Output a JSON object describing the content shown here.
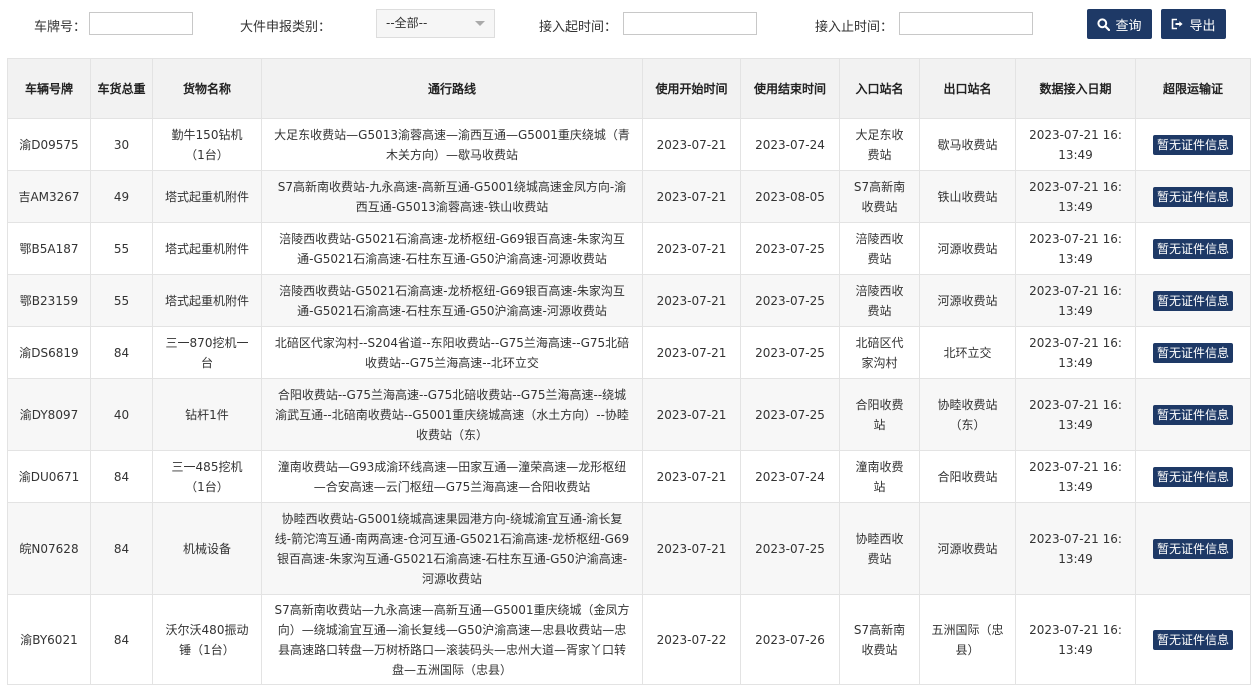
{
  "filters": {
    "plate_label": "车牌号：",
    "plate_value": "",
    "category_label": "大件申报类别：",
    "category_selected": "--全部--",
    "start_label": "接入起时间：",
    "start_value": "",
    "end_label": "接入止时间：",
    "end_value": "",
    "query_label": "查询",
    "export_label": "导出"
  },
  "icons": {
    "query": "search-icon",
    "export": "export-icon"
  },
  "colors": {
    "button": "#1e3966",
    "header_bg": "#f2f2f2"
  },
  "table": {
    "headers": [
      "车辆号牌",
      "车货总重",
      "货物名称",
      "通行路线",
      "使用开始时间",
      "使用结束时间",
      "入口站名",
      "出口站名",
      "数据接入日期",
      "超限运输证"
    ],
    "rows": [
      {
        "plate": "渝D09575",
        "weight": "30",
        "goods": "勤牛150钻机（1台）",
        "route": "大足东收费站—G5013渝蓉高速—渝西互通—G5001重庆绕城（青木关方向）—歇马收费站",
        "start": "2023-07-21",
        "end": "2023-07-24",
        "entry": "大足东收费站",
        "exit": "歇马收费站",
        "date": "2023-07-21 16:13:49",
        "cert": "暂无证件信息"
      },
      {
        "plate": "吉AM3267",
        "weight": "49",
        "goods": "塔式起重机附件",
        "route": "S7高新南收费站-九永高速-高新互通-G5001绕城高速金凤方向-渝西互通-G5013渝蓉高速-铁山收费站",
        "start": "2023-07-21",
        "end": "2023-08-05",
        "entry": "S7高新南收费站",
        "exit": "铁山收费站",
        "date": "2023-07-21 16:13:49",
        "cert": "暂无证件信息"
      },
      {
        "plate": "鄂B5A187",
        "weight": "55",
        "goods": "塔式起重机附件",
        "route": "涪陵西收费站-G5021石渝高速-龙桥枢纽-G69银百高速-朱家沟互通-G5021石渝高速-石柱东互通-G50沪渝高速-河源收费站",
        "start": "2023-07-21",
        "end": "2023-07-25",
        "entry": "涪陵西收费站",
        "exit": "河源收费站",
        "date": "2023-07-21 16:13:49",
        "cert": "暂无证件信息"
      },
      {
        "plate": "鄂B23159",
        "weight": "55",
        "goods": "塔式起重机附件",
        "route": "涪陵西收费站-G5021石渝高速-龙桥枢纽-G69银百高速-朱家沟互通-G5021石渝高速-石柱东互通-G50沪渝高速-河源收费站",
        "start": "2023-07-21",
        "end": "2023-07-25",
        "entry": "涪陵西收费站",
        "exit": "河源收费站",
        "date": "2023-07-21 16:13:49",
        "cert": "暂无证件信息"
      },
      {
        "plate": "渝DS6819",
        "weight": "84",
        "goods": "三一870挖机一台",
        "route": "北碚区代家沟村--S204省道--东阳收费站--G75兰海高速--G75北碚收费站--G75兰海高速--北环立交",
        "start": "2023-07-21",
        "end": "2023-07-25",
        "entry": "北碚区代家沟村",
        "exit": "北环立交",
        "date": "2023-07-21 16:13:49",
        "cert": "暂无证件信息"
      },
      {
        "plate": "渝DY8097",
        "weight": "40",
        "goods": "钻杆1件",
        "route": "合阳收费站--G75兰海高速--G75北碚收费站--G75兰海高速--绕城渝武互通--北碚南收费站--G5001重庆绕城高速（水土方向）--协睦收费站（东）",
        "start": "2023-07-21",
        "end": "2023-07-25",
        "entry": "合阳收费站",
        "exit": "协睦收费站（东）",
        "date": "2023-07-21 16:13:49",
        "cert": "暂无证件信息"
      },
      {
        "plate": "渝DU0671",
        "weight": "84",
        "goods": "三一485挖机（1台）",
        "route": "潼南收费站—G93成渝环线高速—田家互通—潼荣高速—龙形枢纽—合安高速—云门枢纽—G75兰海高速—合阳收费站",
        "start": "2023-07-21",
        "end": "2023-07-24",
        "entry": "潼南收费站",
        "exit": "合阳收费站",
        "date": "2023-07-21 16:13:49",
        "cert": "暂无证件信息"
      },
      {
        "plate": "皖N07628",
        "weight": "84",
        "goods": "机械设备",
        "route": "协睦西收费站-G5001绕城高速果园港方向-绕城渝宜互通-渝长复线-箭沱湾互通-南两高速-仓河互通-G5021石渝高速-龙桥枢纽-G69银百高速-朱家沟互通-G5021石渝高速-石柱东互通-G50沪渝高速-河源收费站",
        "start": "2023-07-21",
        "end": "2023-07-25",
        "entry": "协睦西收费站",
        "exit": "河源收费站",
        "date": "2023-07-21 16:13:49",
        "cert": "暂无证件信息"
      },
      {
        "plate": "渝BY6021",
        "weight": "84",
        "goods": "沃尔沃480振动锤（1台）",
        "route": "S7高新南收费站—九永高速—高新互通—G5001重庆绕城（金凤方向）—绕城渝宜互通—渝长复线—G50沪渝高速—忠县收费站—忠县高速路口转盘—万树桥路口—滚装码头—忠州大道—胥家丫口转盘—五洲国际（忠县）",
        "start": "2023-07-22",
        "end": "2023-07-26",
        "entry": "S7高新南收费站",
        "exit": "五洲国际（忠县）",
        "date": "2023-07-21 16:13:49",
        "cert": "暂无证件信息"
      }
    ]
  }
}
